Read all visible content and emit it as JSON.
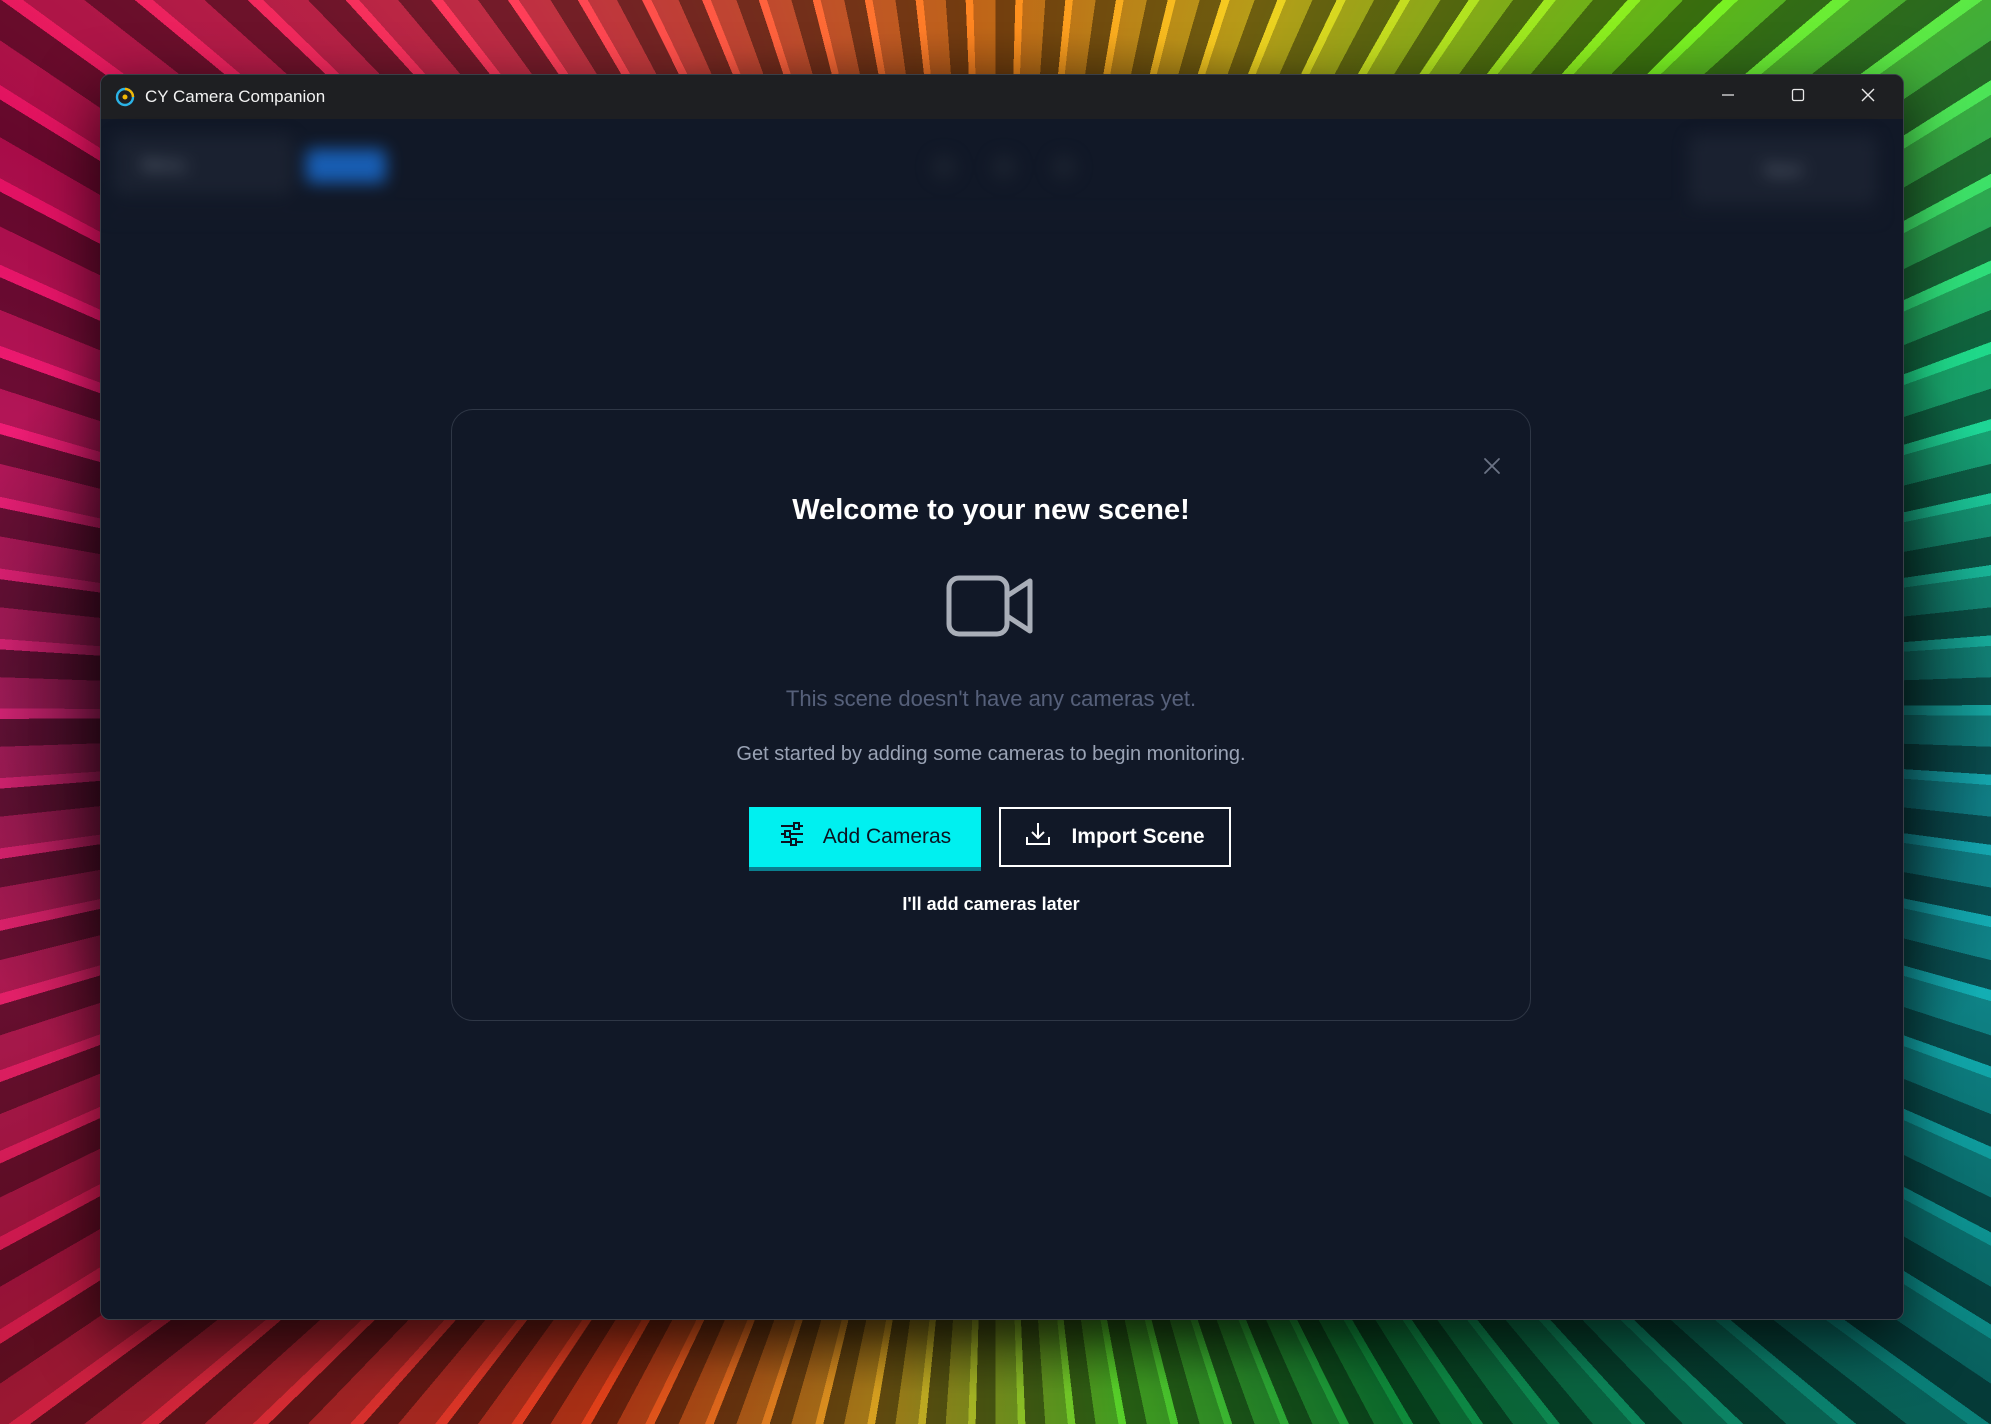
{
  "window": {
    "title": "CY Camera Companion",
    "icon": "cy-logo-icon",
    "controls": [
      "minimize-icon",
      "maximize-icon",
      "close-icon"
    ]
  },
  "toolbar_blurred": {
    "menu_label": "Menu",
    "next_label": "Next"
  },
  "dialog": {
    "title": "Welcome to your new scene!",
    "icon": "video-camera-icon",
    "empty_text": "This scene doesn't have any cameras yet.",
    "hint_text": "Get started by adding some cameras to begin monitoring.",
    "add_cameras_label": "Add Cameras",
    "add_cameras_icon": "sliders-icon",
    "import_scene_label": "Import Scene",
    "import_scene_icon": "download-icon",
    "later_label": "I'll add cameras later",
    "close_icon": "close-icon"
  },
  "colors": {
    "background": "#111827",
    "accent": "#00f0f0",
    "titlebar": "#1e1f22"
  }
}
